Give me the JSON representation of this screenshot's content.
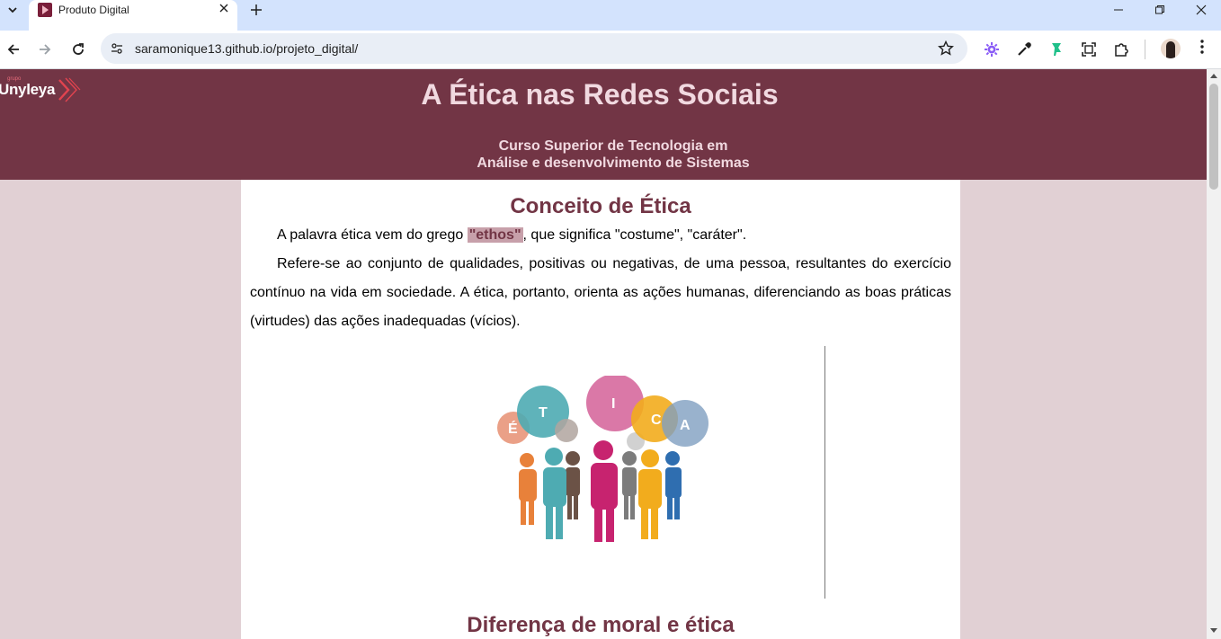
{
  "browser": {
    "tab_title": "Produto Digital",
    "url": "saramonique13.github.io/projeto_digital/",
    "icons": [
      "tab-list-icon",
      "close-icon",
      "plus-icon",
      "minimize-icon",
      "restore-icon",
      "close-window-icon",
      "back-icon",
      "forward-icon",
      "reload-icon",
      "site-settings-icon",
      "star-icon",
      "extension-icon",
      "eyedropper-icon",
      "bookmark-leaf-icon",
      "screenshot-icon",
      "puzzle-icon",
      "avatar",
      "more-icon"
    ]
  },
  "header": {
    "logo_small": "grupo",
    "logo_text": "Unyleya",
    "title": "A Ética nas Redes Sociais",
    "subtitle_line1": "Curso Superior de Tecnologia em",
    "subtitle_line2": "Análise e desenvolvimento de Sistemas",
    "colors": {
      "header_bg": "#723545",
      "page_bg": "#e1d0d4",
      "accent": "#723545"
    }
  },
  "content": {
    "section1_title": "Conceito de Ética",
    "p1_before": "A palavra ética vem do grego ",
    "p1_highlight": "\"ethos\"",
    "p1_after": ", que significa \"costume\", \"caráter\".",
    "p2": "Refere-se ao conjunto de qualidades, positivas ou negativas, de uma pessoa, resultantes do exercício contínuo na vida em sociedade. A ética, portanto, orienta as ações humanas, diferenciando as boas práticas (virtudes) das ações inadequadas (vícios).",
    "image_letters": [
      "É",
      "T",
      "I",
      "C",
      "A"
    ],
    "image_caption": "",
    "section2_title": "Diferença de moral e ética"
  }
}
